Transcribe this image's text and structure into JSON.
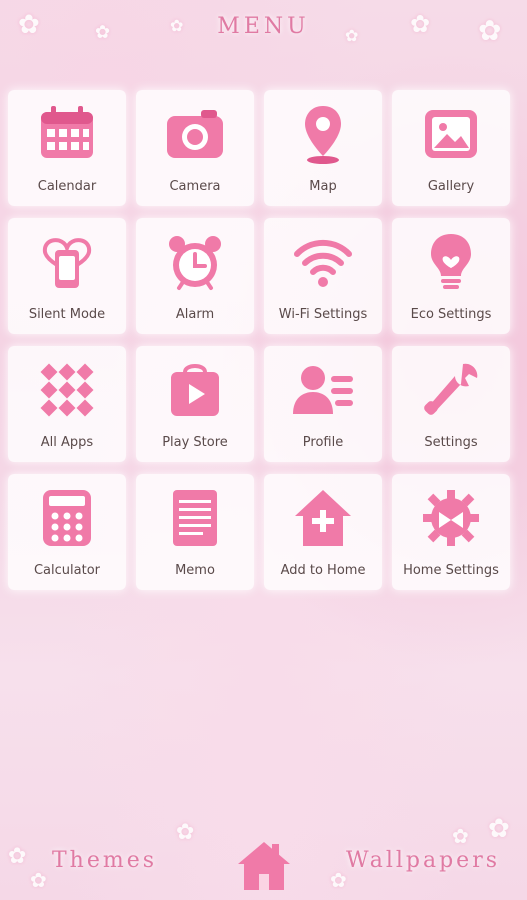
{
  "header": {
    "title": "MENU"
  },
  "apps": [
    {
      "label": "Calendar",
      "icon": "calendar-icon"
    },
    {
      "label": "Camera",
      "icon": "camera-icon"
    },
    {
      "label": "Map",
      "icon": "map-pin-icon"
    },
    {
      "label": "Gallery",
      "icon": "gallery-icon"
    },
    {
      "label": "Silent Mode",
      "icon": "silent-mode-icon"
    },
    {
      "label": "Alarm",
      "icon": "alarm-clock-icon"
    },
    {
      "label": "Wi-Fi Settings",
      "icon": "wifi-icon"
    },
    {
      "label": "Eco Settings",
      "icon": "eco-bulb-icon"
    },
    {
      "label": "All Apps",
      "icon": "all-apps-icon"
    },
    {
      "label": "Play Store",
      "icon": "play-store-icon"
    },
    {
      "label": "Profile",
      "icon": "profile-icon"
    },
    {
      "label": "Settings",
      "icon": "wrench-icon"
    },
    {
      "label": "Calculator",
      "icon": "calculator-icon"
    },
    {
      "label": "Memo",
      "icon": "memo-icon"
    },
    {
      "label": "Add to Home",
      "icon": "add-home-icon"
    },
    {
      "label": "Home Settings",
      "icon": "home-settings-icon"
    }
  ],
  "bottom_bar": {
    "themes_label": "Themes",
    "wallpapers_label": "Wallpapers",
    "home_icon": "home-icon"
  },
  "colors": {
    "accent": "#e07aa3",
    "icon_pink": "#f07aa8",
    "label": "#5a4a4a"
  }
}
